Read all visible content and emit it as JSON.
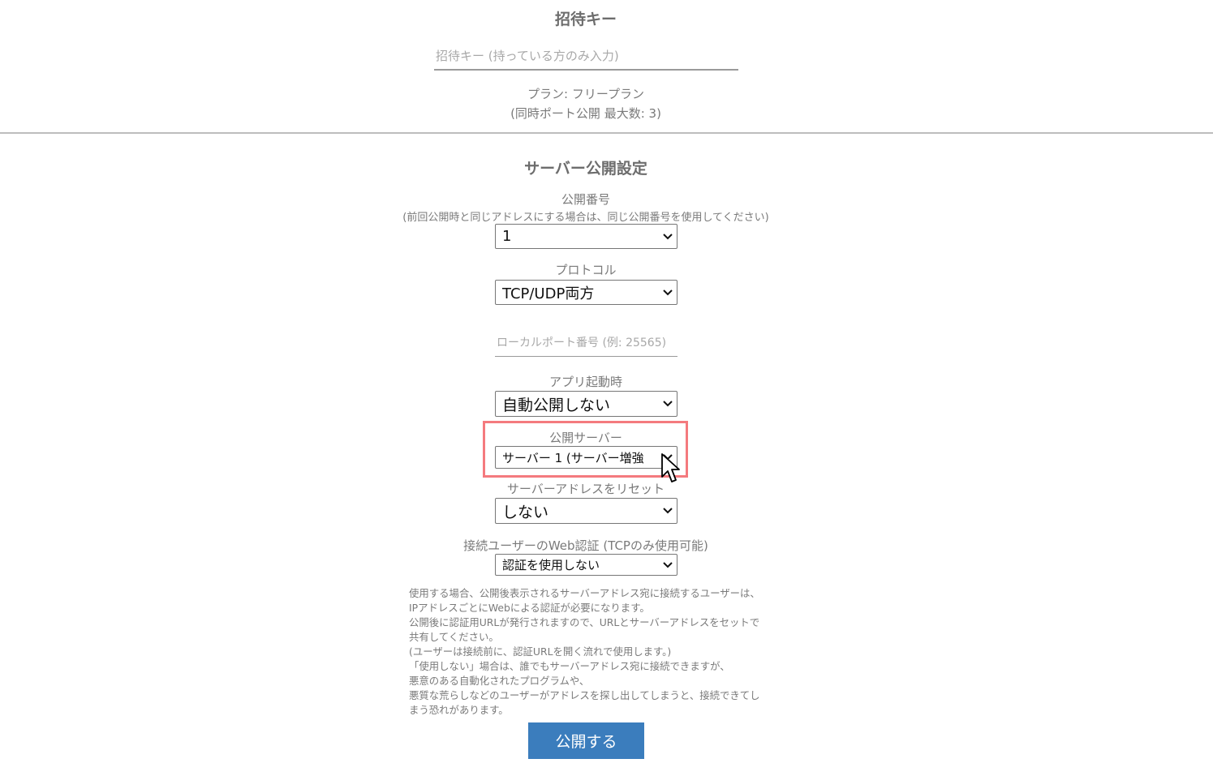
{
  "invite": {
    "heading": "招待キー",
    "placeholder": "招待キー (持っている方のみ入力)",
    "plan_line": "プラン: フリープラン",
    "plan_limit": "(同時ポート公開 最大数: 3)"
  },
  "server_settings": {
    "heading": "サーバー公開設定",
    "public_number": {
      "label": "公開番号",
      "note": "(前回公開時と同じアドレスにする場合は、同じ公開番号を使用してください)",
      "value": "1"
    },
    "protocol": {
      "label": "プロトコル",
      "value": "TCP/UDP両方"
    },
    "local_port": {
      "placeholder": "ローカルポート番号 (例: 25565)"
    },
    "on_app_start": {
      "label": "アプリ起動時",
      "value": "自動公開しない"
    },
    "public_server": {
      "label": "公開サーバー",
      "value": "サーバー 1 (サーバー増強"
    },
    "reset_address": {
      "label": "サーバーアドレスをリセット",
      "value": "しない"
    },
    "web_auth": {
      "label": "接続ユーザーのWeb認証 (TCPのみ使用可能)",
      "value": "認証を使用しない"
    },
    "description": [
      "使用する場合、公開後表示されるサーバーアドレス宛に接続するユーザーは、",
      "IPアドレスごとにWebによる認証が必要になります。",
      "公開後に認証用URLが発行されますので、URLとサーバーアドレスをセットで",
      "共有してください。",
      "(ユーザーは接続前に、認証URLを開く流れで使用します。)",
      "「使用しない」場合は、誰でもサーバーアドレス宛に接続できますが、",
      "悪意のある自動化されたプログラムや、",
      "悪質な荒らしなどのユーザーがアドレスを探し出してしまうと、接続できてし",
      "まう恐れがあります。"
    ],
    "publish_button": "公開する"
  },
  "icons": {
    "dropdown": "chevron-down-icon",
    "cursor": "mouse-pointer-icon"
  },
  "colors": {
    "highlight": "#f47a7e",
    "button": "#3b7dbd"
  }
}
